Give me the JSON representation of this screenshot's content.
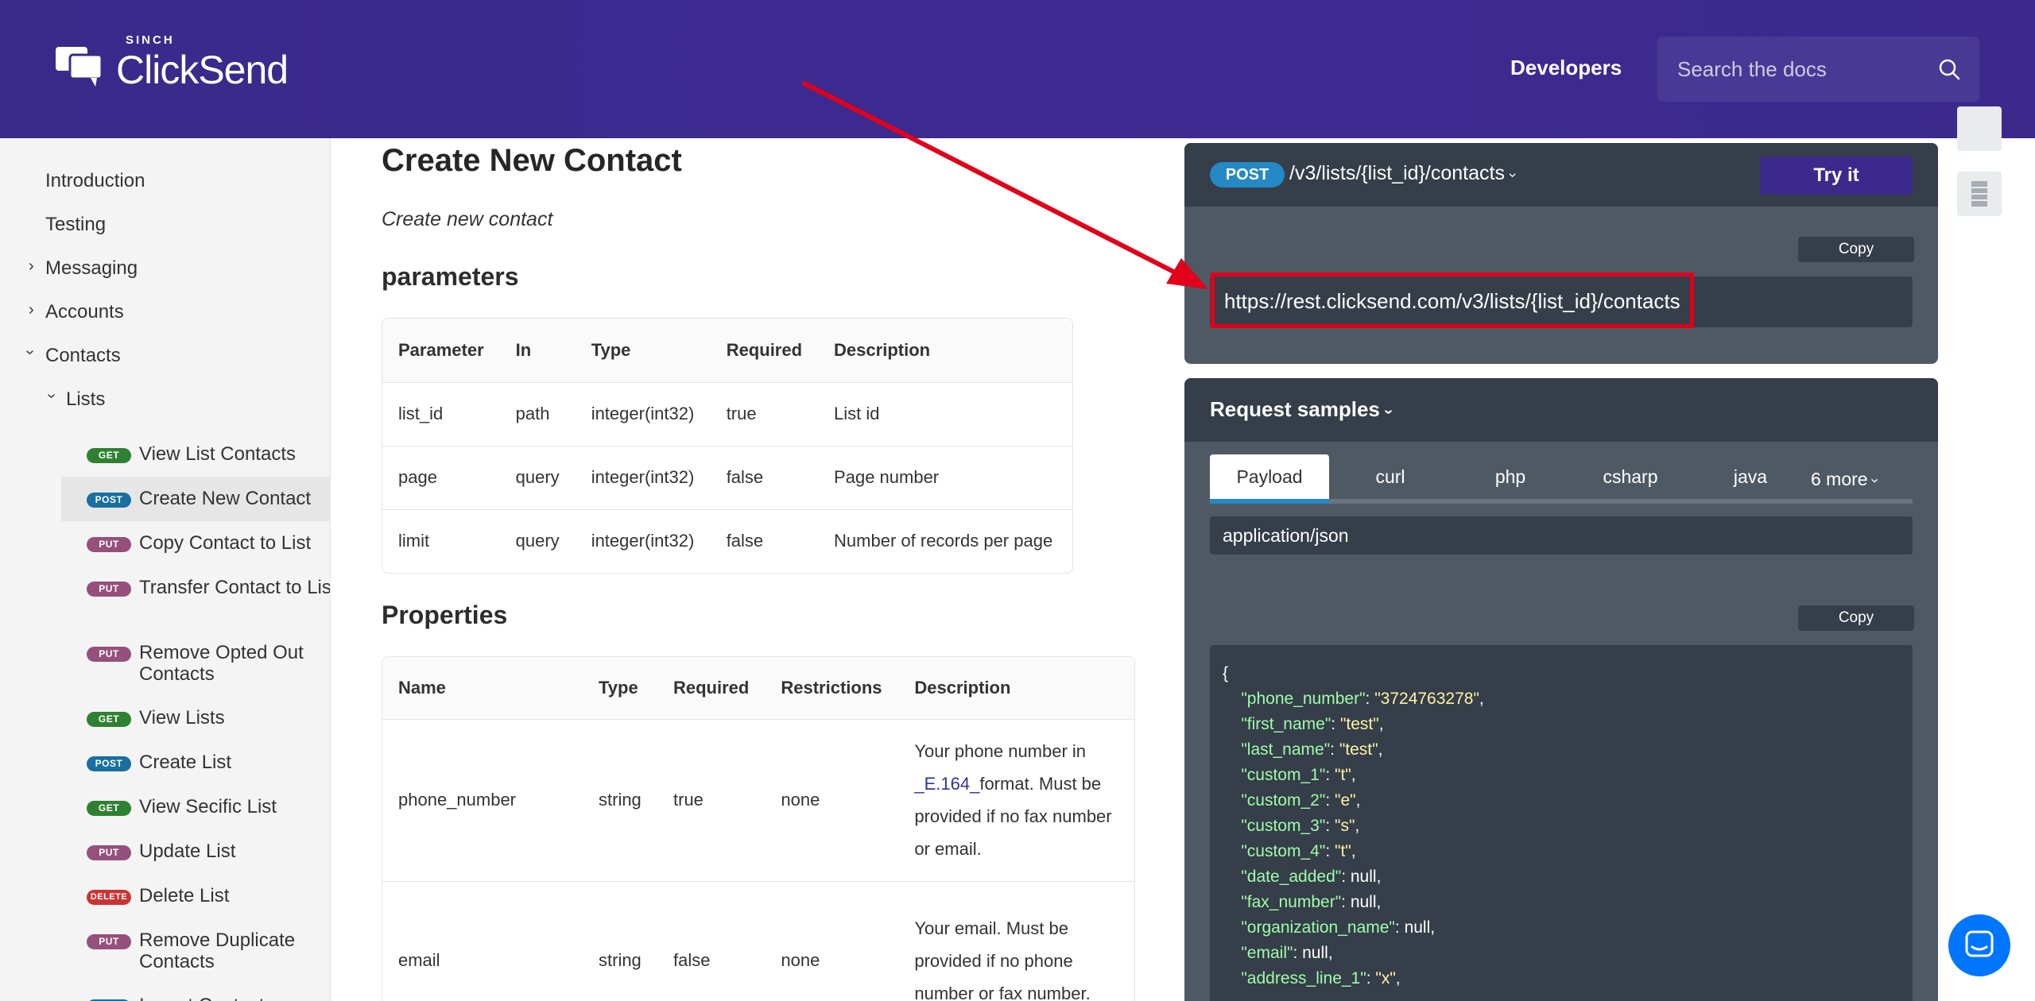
{
  "header": {
    "brand_top": "SINCH",
    "brand_name": "ClickSend",
    "nav_developers": "Developers",
    "search_placeholder": "Search the docs"
  },
  "sidebar": {
    "top_items": [
      {
        "label": "Introduction"
      },
      {
        "label": "Testing"
      },
      {
        "label": "Messaging"
      },
      {
        "label": "Accounts"
      },
      {
        "label": "Contacts"
      },
      {
        "label": "Lists"
      }
    ],
    "operations": [
      {
        "method": "GET",
        "label": "View List Contacts"
      },
      {
        "method": "POST",
        "label": "Create New Contact"
      },
      {
        "method": "PUT",
        "label": "Copy Contact to List"
      },
      {
        "method": "PUT",
        "label": "Transfer Contact to List"
      },
      {
        "method": "PUT",
        "label": "Remove Opted Out Contacts"
      },
      {
        "method": "GET",
        "label": "View Lists"
      },
      {
        "method": "POST",
        "label": "Create List"
      },
      {
        "method": "GET",
        "label": "View Secific List"
      },
      {
        "method": "PUT",
        "label": "Update List"
      },
      {
        "method": "DELETE",
        "label": "Delete List"
      },
      {
        "method": "PUT",
        "label": "Remove Duplicate Contacts"
      },
      {
        "method": "POST",
        "label": "Import Contacts"
      }
    ]
  },
  "main": {
    "title": "Create New Contact",
    "description": "Create new contact",
    "params_heading": "parameters",
    "params_table": {
      "headers": [
        "Parameter",
        "In",
        "Type",
        "Required",
        "Description"
      ],
      "rows": [
        [
          "list_id",
          "path",
          "integer(int32)",
          "true",
          "List id"
        ],
        [
          "page",
          "query",
          "integer(int32)",
          "false",
          "Page number"
        ],
        [
          "limit",
          "query",
          "integer(int32)",
          "false",
          "Number of records per page"
        ]
      ]
    },
    "props_heading": "Properties",
    "props_table": {
      "headers": [
        "Name",
        "Type",
        "Required",
        "Restrictions",
        "Description"
      ],
      "rows": [
        {
          "name": "phone_number",
          "type": "string",
          "required": "true",
          "restrictions": "none",
          "desc_a": "Your phone number in",
          "desc_link": "_E.164_",
          "desc_b": "format. Must be provided if no fax number or email."
        },
        {
          "name": "email",
          "type": "string",
          "required": "false",
          "restrictions": "none",
          "desc_a": "Your email. Must be provided if no phone number or fax number.",
          "desc_link": "",
          "desc_b": ""
        }
      ]
    }
  },
  "endpoint": {
    "method": "POST",
    "path": "/v3/lists/{list_id}/contacts",
    "try_label": "Try it",
    "copy_label": "Copy",
    "url": "https://rest.clicksend.com/v3/lists/{list_id}/contacts"
  },
  "samples": {
    "title": "Request samples",
    "tabs": [
      "Payload",
      "curl",
      "php",
      "csharp",
      "java"
    ],
    "more_label": "6 more",
    "content_type": "application/json",
    "copy_label": "Copy",
    "code": {
      "open": "{",
      "fields": [
        {
          "key": "\"phone_number\"",
          "value": "\"3724763278\"",
          "is_string": true
        },
        {
          "key": "\"first_name\"",
          "value": "\"test\"",
          "is_string": true
        },
        {
          "key": "\"last_name\"",
          "value": "\"test\"",
          "is_string": true
        },
        {
          "key": "\"custom_1\"",
          "value": "\"t\"",
          "is_string": true
        },
        {
          "key": "\"custom_2\"",
          "value": "\"e\"",
          "is_string": true
        },
        {
          "key": "\"custom_3\"",
          "value": "\"s\"",
          "is_string": true
        },
        {
          "key": "\"custom_4\"",
          "value": "\"t\"",
          "is_string": true
        },
        {
          "key": "\"date_added\"",
          "value": "null",
          "is_string": false
        },
        {
          "key": "\"fax_number\"",
          "value": "null",
          "is_string": false
        },
        {
          "key": "\"organization_name\"",
          "value": "null",
          "is_string": false
        },
        {
          "key": "\"email\"",
          "value": "null",
          "is_string": false
        },
        {
          "key": "\"address_line_1\"",
          "value": "\"x\"",
          "is_string": true
        }
      ]
    }
  },
  "colors": {
    "header_bg": "#3b2a8c",
    "panel_bg": "#4f5964",
    "panel_dark": "#353e49",
    "accent_red": "#e2001a",
    "link": "#32329f"
  }
}
